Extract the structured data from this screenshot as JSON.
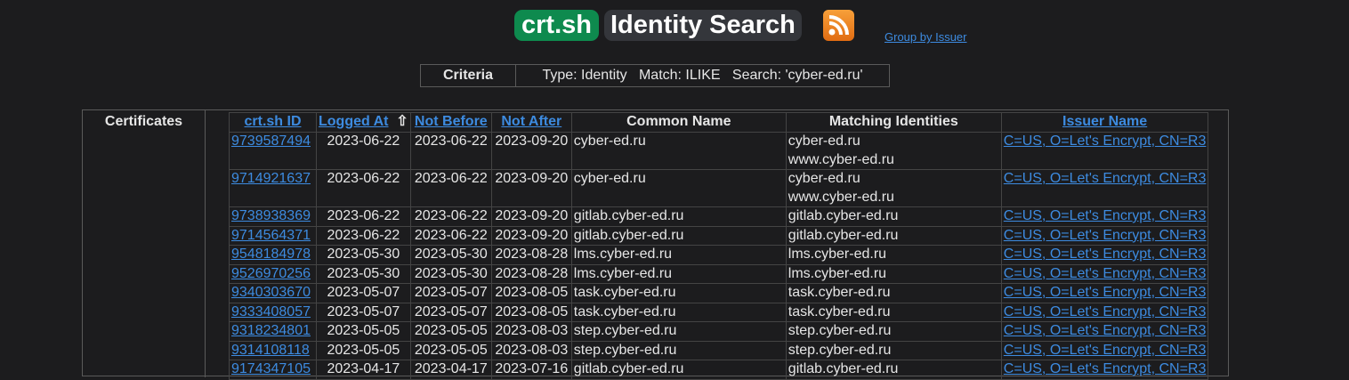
{
  "header": {
    "logo": "crt.sh",
    "title": "Identity Search",
    "group_link": "Group by Issuer"
  },
  "criteria": {
    "label": "Criteria",
    "text": "Type: Identity   Match: ILIKE   Search: 'cyber-ed.ru'"
  },
  "certificates": {
    "label": "Certificates",
    "columns": [
      "crt.sh ID",
      "Logged At",
      "Not Before",
      "Not After",
      "Common Name",
      "Matching Identities",
      "Issuer Name"
    ],
    "sort_indicator": "⇧",
    "rows": [
      {
        "id": "9739587494",
        "logged": "2023-06-22",
        "nb": "2023-06-22",
        "na": "2023-09-20",
        "cn": "cyber-ed.ru",
        "mi": [
          "cyber-ed.ru",
          "www.cyber-ed.ru"
        ],
        "iss": "C=US, O=Let's Encrypt, CN=R3"
      },
      {
        "id": "9714921637",
        "logged": "2023-06-22",
        "nb": "2023-06-22",
        "na": "2023-09-20",
        "cn": "cyber-ed.ru",
        "mi": [
          "cyber-ed.ru",
          "www.cyber-ed.ru"
        ],
        "iss": "C=US, O=Let's Encrypt, CN=R3"
      },
      {
        "id": "9738938369",
        "logged": "2023-06-22",
        "nb": "2023-06-22",
        "na": "2023-09-20",
        "cn": "gitlab.cyber-ed.ru",
        "mi": [
          "gitlab.cyber-ed.ru"
        ],
        "iss": "C=US, O=Let's Encrypt, CN=R3"
      },
      {
        "id": "9714564371",
        "logged": "2023-06-22",
        "nb": "2023-06-22",
        "na": "2023-09-20",
        "cn": "gitlab.cyber-ed.ru",
        "mi": [
          "gitlab.cyber-ed.ru"
        ],
        "iss": "C=US, O=Let's Encrypt, CN=R3"
      },
      {
        "id": "9548184978",
        "logged": "2023-05-30",
        "nb": "2023-05-30",
        "na": "2023-08-28",
        "cn": "lms.cyber-ed.ru",
        "mi": [
          "lms.cyber-ed.ru"
        ],
        "iss": "C=US, O=Let's Encrypt, CN=R3"
      },
      {
        "id": "9526970256",
        "logged": "2023-05-30",
        "nb": "2023-05-30",
        "na": "2023-08-28",
        "cn": "lms.cyber-ed.ru",
        "mi": [
          "lms.cyber-ed.ru"
        ],
        "iss": "C=US, O=Let's Encrypt, CN=R3"
      },
      {
        "id": "9340303670",
        "logged": "2023-05-07",
        "nb": "2023-05-07",
        "na": "2023-08-05",
        "cn": "task.cyber-ed.ru",
        "mi": [
          "task.cyber-ed.ru"
        ],
        "iss": "C=US, O=Let's Encrypt, CN=R3"
      },
      {
        "id": "9333408057",
        "logged": "2023-05-07",
        "nb": "2023-05-07",
        "na": "2023-08-05",
        "cn": "task.cyber-ed.ru",
        "mi": [
          "task.cyber-ed.ru"
        ],
        "iss": "C=US, O=Let's Encrypt, CN=R3"
      },
      {
        "id": "9318234801",
        "logged": "2023-05-05",
        "nb": "2023-05-05",
        "na": "2023-08-03",
        "cn": "step.cyber-ed.ru",
        "mi": [
          "step.cyber-ed.ru"
        ],
        "iss": "C=US, O=Let's Encrypt, CN=R3"
      },
      {
        "id": "9314108118",
        "logged": "2023-05-05",
        "nb": "2023-05-05",
        "na": "2023-08-03",
        "cn": "step.cyber-ed.ru",
        "mi": [
          "step.cyber-ed.ru"
        ],
        "iss": "C=US, O=Let's Encrypt, CN=R3"
      },
      {
        "id": "9174347105",
        "logged": "2023-04-17",
        "nb": "2023-04-17",
        "na": "2023-07-16",
        "cn": "gitlab.cyber-ed.ru",
        "mi": [
          "gitlab.cyber-ed.ru"
        ],
        "iss": "C=US, O=Let's Encrypt, CN=R3"
      }
    ]
  }
}
